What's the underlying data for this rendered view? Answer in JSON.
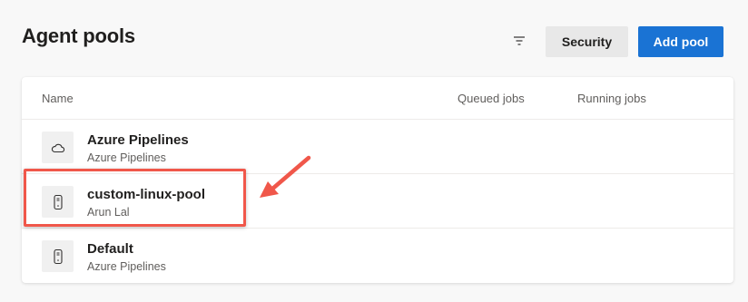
{
  "header": {
    "title": "Agent pools",
    "filter_icon": "filter-icon",
    "security_label": "Security",
    "add_pool_label": "Add pool"
  },
  "table": {
    "columns": [
      "Name",
      "Queued jobs",
      "Running jobs"
    ],
    "rows": [
      {
        "name": "Azure Pipelines",
        "subtitle": "Azure Pipelines",
        "icon": "cloud-icon"
      },
      {
        "name": "custom-linux-pool",
        "subtitle": "Arun Lal",
        "icon": "agent-device-icon"
      },
      {
        "name": "Default",
        "subtitle": "Azure Pipelines",
        "icon": "agent-device-icon"
      }
    ]
  },
  "colors": {
    "primary_button": "#1a73d4",
    "annotation": "#f0574a"
  }
}
